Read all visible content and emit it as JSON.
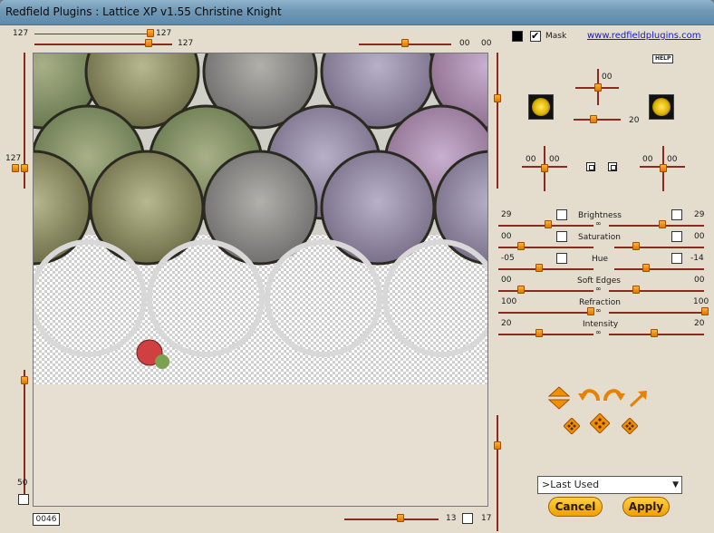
{
  "window": {
    "title": "Redfield Plugins : Lattice XP v1.55   Christine Knight"
  },
  "top_sliders": {
    "left_a": "127",
    "left_b": "127",
    "right_a": "00",
    "right_b": "00"
  },
  "left_sliders": {
    "top_value": "127",
    "bottom_value": "50"
  },
  "bottom_slider": {
    "value": "13",
    "value2": "17",
    "counter": "0046"
  },
  "header_right": {
    "mask_label": "Mask",
    "link": "www.redfieldplugins.com",
    "help": "HELP"
  },
  "light": {
    "top_a": "00",
    "top_b": "20",
    "left_a": "00",
    "left_b": "00",
    "right_a": "00",
    "right_b": "00"
  },
  "adjustments": [
    {
      "name": "Brightness",
      "left": "29",
      "right": "29"
    },
    {
      "name": "Saturation",
      "left": "00",
      "right": "00"
    },
    {
      "name": "Hue",
      "left": "-05",
      "right": "-14"
    },
    {
      "name": "Soft Edges",
      "left": "00",
      "right": "00"
    },
    {
      "name": "Refraction",
      "left": "100",
      "right": "100"
    },
    {
      "name": "Intensity",
      "left": "20",
      "right": "20"
    }
  ],
  "preset": {
    "selected": ">Last Used"
  },
  "buttons": {
    "cancel": "Cancel",
    "apply": "Apply"
  },
  "colors": {
    "accent": "#e88a00",
    "slider_track": "#8a2a20",
    "panel_bg": "#e4dccd"
  }
}
